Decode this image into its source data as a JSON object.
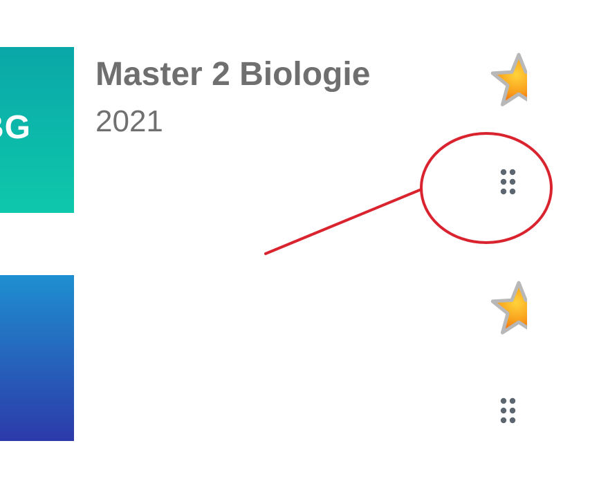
{
  "courses": [
    {
      "thumbnail_text": "BG",
      "thumbnail_colors": [
        "#0aa7a8",
        "#0ec8ab"
      ],
      "title": "Master 2 Biologie",
      "year": "2021",
      "favorite_icon": "star-icon",
      "drag_icon": "drag-handle-icon"
    },
    {
      "thumbnail_text": "",
      "thumbnail_colors": [
        "#1f8fd0",
        "#2c3aa9"
      ],
      "title": "",
      "year": "",
      "favorite_icon": "star-icon",
      "drag_icon": "drag-handle-icon"
    }
  ],
  "annotation": {
    "color": "#d9232e",
    "shape": "ellipse-with-arrow-line",
    "target": "drag-handle-icon"
  },
  "colors": {
    "text_primary": "#6f6f6f",
    "text_secondary": "#707070",
    "icon_grey": "#5b6670",
    "star_fill": "#f7a21b",
    "star_outline": "#b9b9b9"
  }
}
